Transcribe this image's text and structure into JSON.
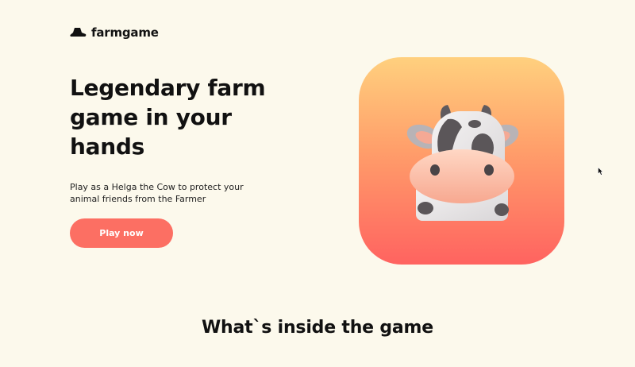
{
  "header": {
    "logo_icon": "farmer-hat-icon",
    "logo_text": "farmgame"
  },
  "hero": {
    "title": "Legendary farm game in your hands",
    "description": "Play as a Helga the Cow to protect your animal friends from the Farmer",
    "cta_label": "Play now"
  },
  "app_icon": {
    "icon": "cow-face-icon",
    "gradient_top": "#ffd07e",
    "gradient_bottom": "#ff6360"
  },
  "features": {
    "title": "What`s inside the game"
  },
  "colors": {
    "background": "#fcf9ec",
    "accent": "#fc6f63",
    "text": "#111111"
  }
}
